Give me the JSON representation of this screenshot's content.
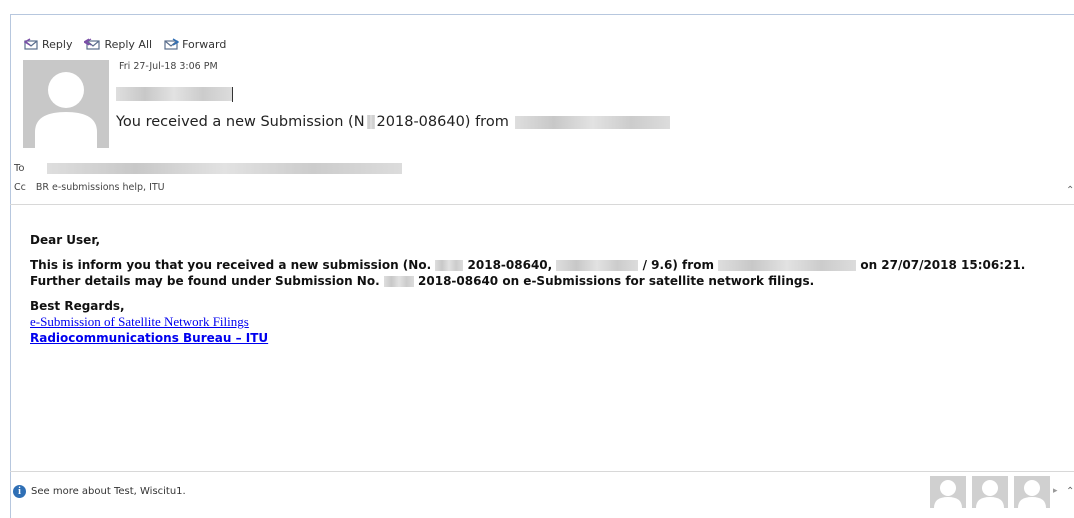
{
  "actions": {
    "reply": "Reply",
    "reply_all": "Reply All",
    "forward": "Forward"
  },
  "header": {
    "date": "Fri 27-Jul-18 3:06 PM",
    "subject_pre": "You received a new Submission (N",
    "subject_num": "2018-08640) from",
    "to_label": "To",
    "cc_label": "Cc",
    "cc_value": "BR e-submissions help, ITU"
  },
  "body": {
    "greeting": "Dear User,",
    "l1_a": "This is inform you that you received a new submission (No.",
    "l1_b": "2018-08640,",
    "l1_c": "/ 9.6) from",
    "l1_d": "on 27/07/2018 15:06:21.",
    "l2_a": "Further details may be found under Submission No.",
    "l2_b": "2018-08640 on e-Submissions for satellite network filings.",
    "regards": "Best Regards,",
    "link1": "e-Submission of Satellite Network Filings",
    "link2": "Radiocommunications Bureau – ITU"
  },
  "footer": {
    "see_more": "See more about Test, Wiscitu1."
  },
  "icons": [
    "reply-icon",
    "reply-all-icon",
    "forward-icon",
    "info-icon",
    "avatar-icon",
    "person-icon"
  ],
  "colors": {
    "link": "#0000ee",
    "info_badge": "#2f6fb5",
    "frame_border": "#b7c7de"
  }
}
